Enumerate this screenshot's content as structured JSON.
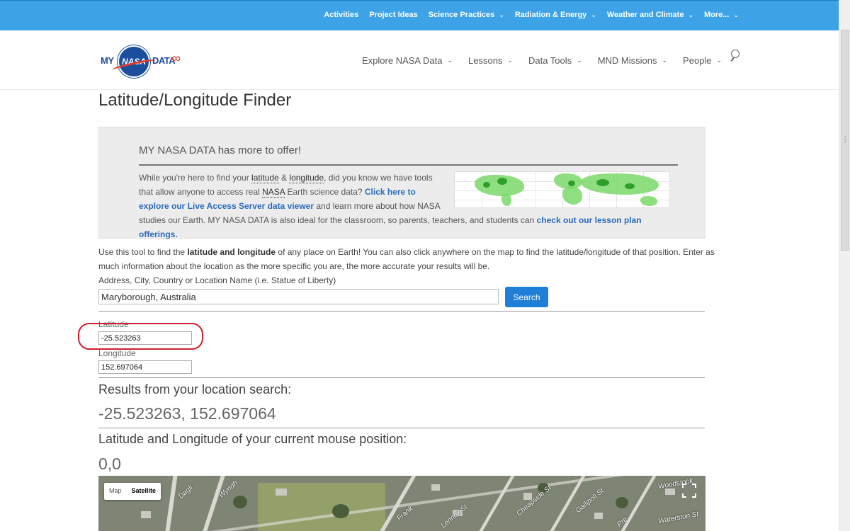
{
  "topnav": {
    "items": [
      {
        "label": "Activities",
        "dropdown": false
      },
      {
        "label": "Project Ideas",
        "dropdown": false
      },
      {
        "label": "Science Practices",
        "dropdown": true
      },
      {
        "label": "Radiation & Energy",
        "dropdown": true
      },
      {
        "label": "Weather and Climate",
        "dropdown": true
      },
      {
        "label": "More...",
        "dropdown": true
      }
    ],
    "bg_color": "#3ea3e6"
  },
  "logo": {
    "left": "MY",
    "center": "NASA",
    "right": "DATA"
  },
  "mainnav": {
    "items": [
      {
        "label": "Explore NASA Data"
      },
      {
        "label": "Lessons"
      },
      {
        "label": "Data Tools"
      },
      {
        "label": "MND Missions"
      },
      {
        "label": "People"
      }
    ],
    "search_icon": "search-icon"
  },
  "page": {
    "title": "Latitude/Longitude Finder"
  },
  "promo": {
    "title": "MY NASA DATA has more to offer!",
    "t1": "While you're here to find your ",
    "latitude": "latitude",
    "amp": " & ",
    "longitude": "longitude",
    "t2": ", did you know we have tools that allow anyone to access real ",
    "nasa": "NASA",
    "t3": " Earth science data? ",
    "link1": "Click here to explore our Live Access Server data viewer",
    "t4": " and learn more about how NASA studies our Earth. MY NASA DATA is also ideal for the classroom, so parents, teachers, and students can ",
    "link2": "check out our lesson plan offerings."
  },
  "intro": {
    "a": "Use this tool to find the ",
    "b": "latitude and longitude",
    "c": " of any place on Earth! You can also click anywhere on the map to find the latitude/longitude of that position. Enter as much information about the location as the more specific you are, the more accurate your results will be."
  },
  "search": {
    "label": "Address, City, Country or Location Name (i.e. Statue of Liberty)",
    "value": "Maryborough, Australia",
    "button": "Search"
  },
  "fields": {
    "lat_label": "Latitude",
    "lat_value": "-25.523263",
    "lon_label": "Longitude",
    "lon_value": "152.697064"
  },
  "results": {
    "heading": "Results from your location search:",
    "value": "-25.523263, 152.697064"
  },
  "mouse": {
    "heading": "Latitude and Longitude of your current mouse position:",
    "value": "0,0"
  },
  "map": {
    "type_map": "Map",
    "type_satellite": "Satellite",
    "selected": "Satellite",
    "labels": [
      "Dagli",
      "Wyndh",
      "Frank",
      "Lennox St",
      "Cheapside St",
      "Gallipoli St",
      "Woodstock",
      "Waterston St",
      "Pre"
    ]
  },
  "colors": {
    "accent": "#1f7fd6",
    "link": "#2a6bbf",
    "highlight": "#d21f2d"
  }
}
